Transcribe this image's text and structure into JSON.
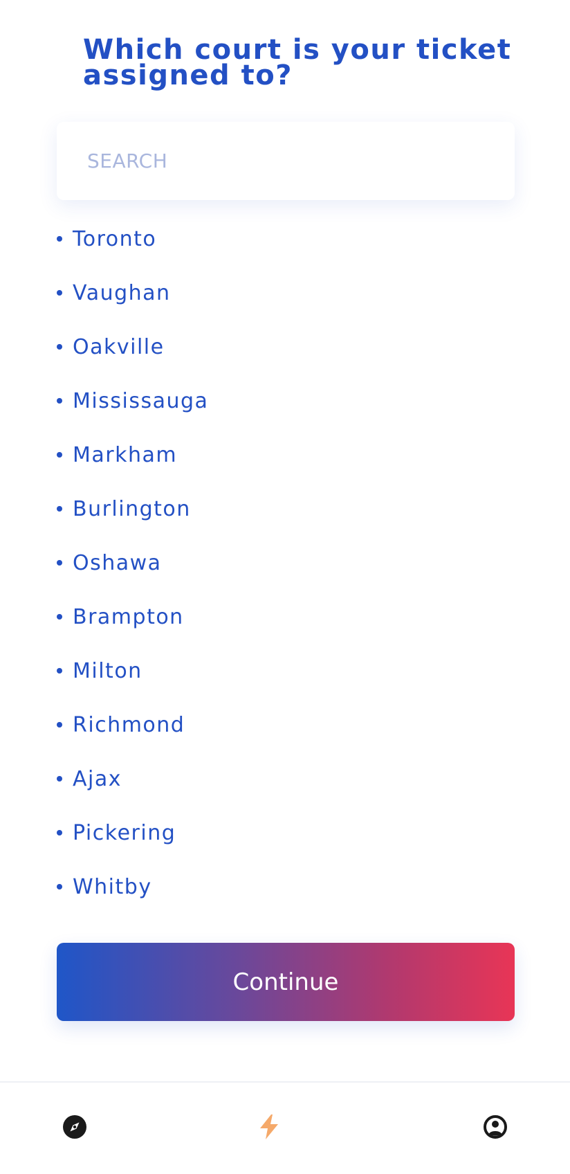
{
  "header": {
    "title": "Which court is your ticket assigned to?"
  },
  "search": {
    "placeholder": "SEARCH",
    "value": ""
  },
  "courts": [
    "Toronto",
    "Vaughan",
    "Oakville",
    "Mississauga",
    "Markham",
    "Burlington",
    "Oshawa",
    "Brampton",
    "Milton",
    "Richmond",
    "Ajax",
    "Pickering",
    "Whitby"
  ],
  "actions": {
    "continue_label": "Continue"
  },
  "bottom_nav": {
    "items": [
      {
        "icon": "compass-icon",
        "active": false
      },
      {
        "icon": "lightning-icon",
        "active": true
      },
      {
        "icon": "user-circle-icon",
        "active": false
      }
    ]
  },
  "colors": {
    "primary": "#2350c4",
    "placeholder": "#a9b6dd",
    "gradient_start": "#1f56c8",
    "gradient_end": "#e83556",
    "active_nav": "#f5a96a",
    "inactive_nav": "#1a1a1a"
  }
}
